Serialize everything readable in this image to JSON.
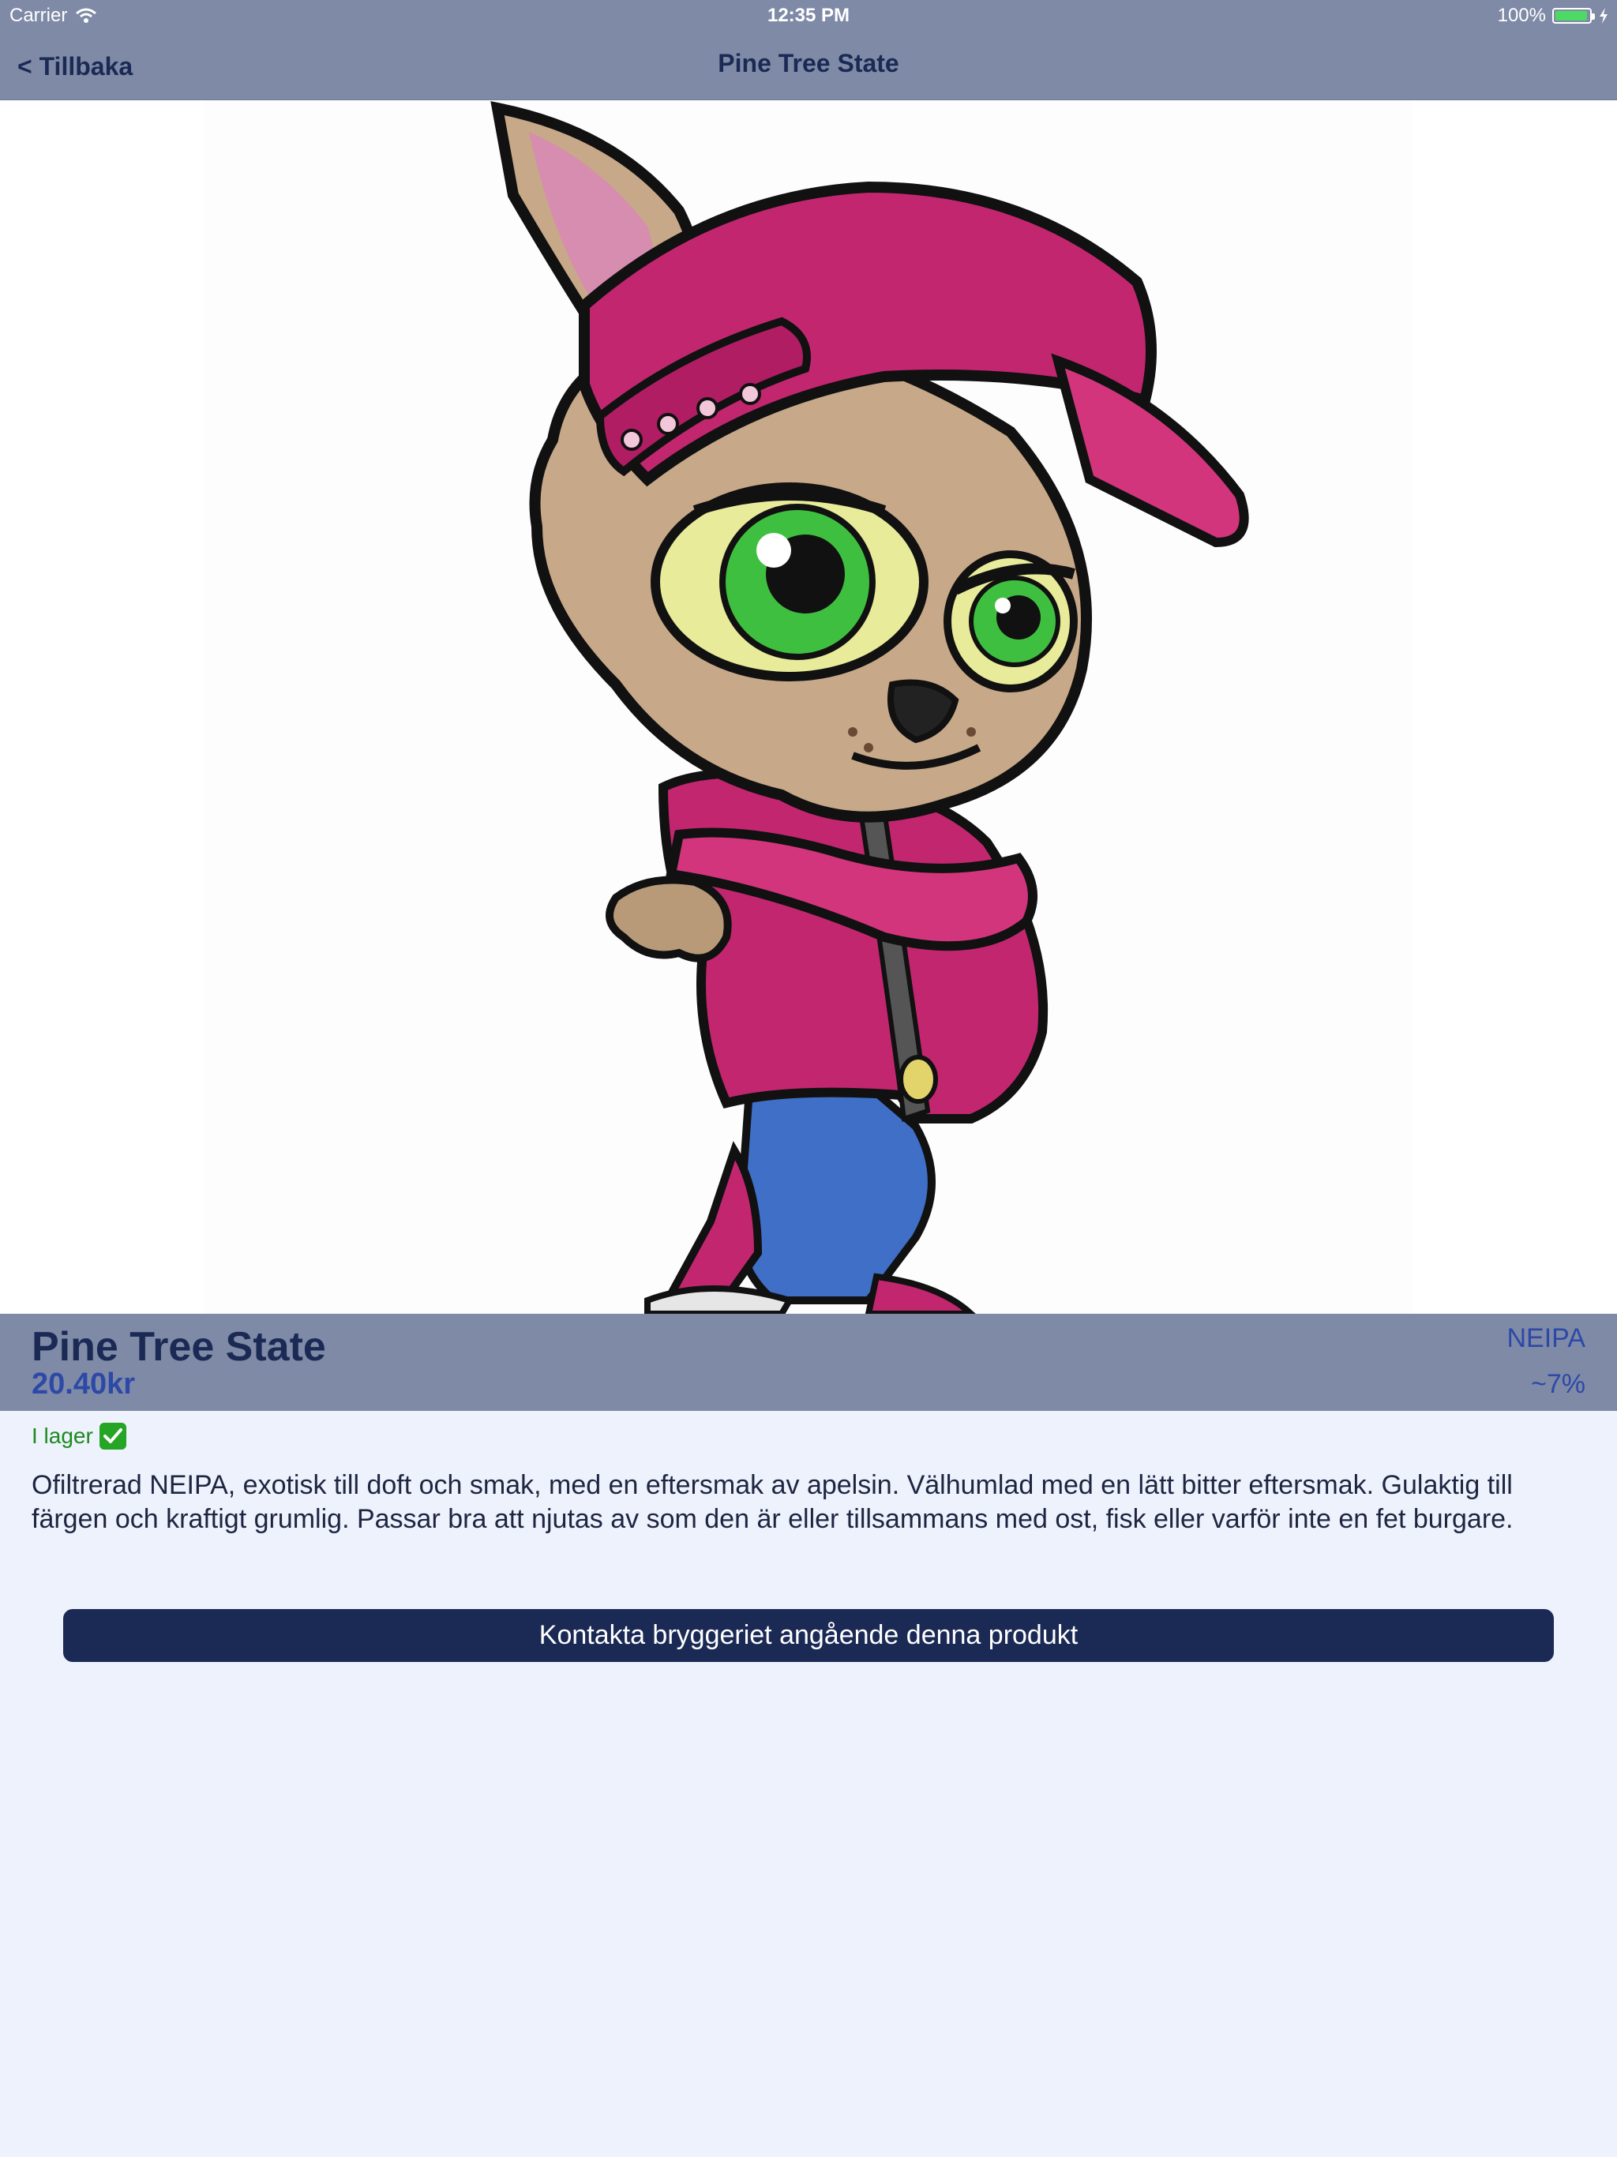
{
  "status_bar": {
    "carrier": "Carrier",
    "time": "12:35 PM",
    "battery": "100%"
  },
  "nav": {
    "back_label": "< Tillbaka",
    "title": "Pine Tree State"
  },
  "product": {
    "name": "Pine Tree State",
    "price": "20.40kr",
    "style": "NEIPA",
    "abv": "~7%",
    "stock": "I lager",
    "description": "Ofiltrerad NEIPA, exotisk till doft och smak, med en eftersmak av apelsin. Välhumlad med en lätt bitter eftersmak. Gulaktig till färgen och kraftigt grumlig. Passar bra att njutas av som den är eller tillsammans med ost, fisk eller varför inte en fet burgare."
  },
  "actions": {
    "contact_label": "Kontakta bryggeriet angående denna produkt"
  },
  "colors": {
    "nav_bar": "#7f8aa6",
    "primary_dark": "#1b2a55",
    "accent_blue": "#2d49a8",
    "background": "#edf2fd",
    "in_stock_green": "#1d8a1d"
  },
  "icons": {
    "wifi": "wifi-icon",
    "battery": "battery-icon",
    "stock_check": "check-icon",
    "hero": "cartoon-cat-mascot"
  }
}
